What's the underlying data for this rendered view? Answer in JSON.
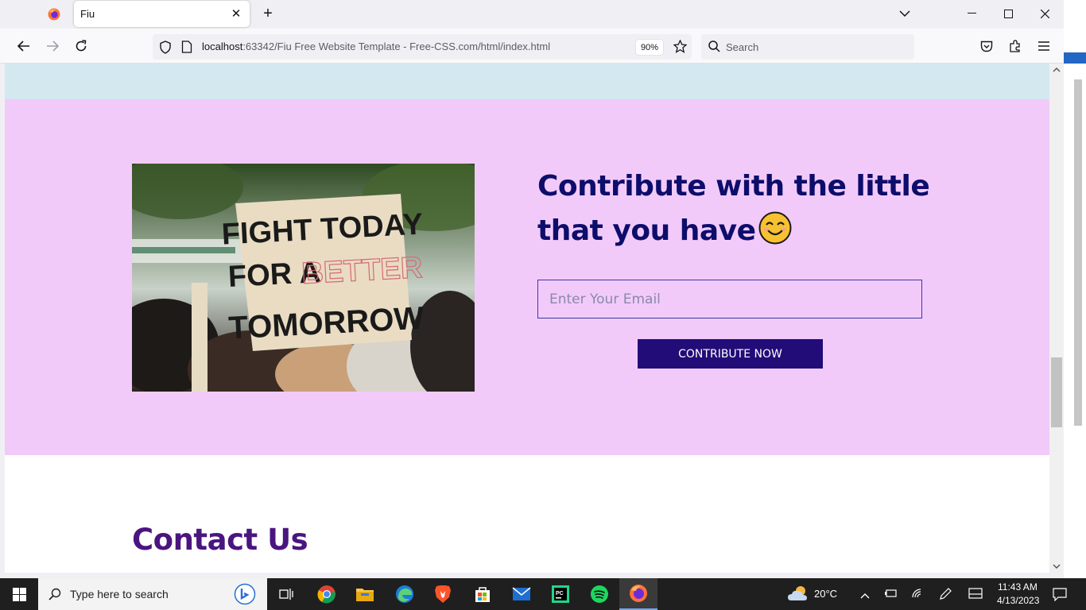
{
  "browser": {
    "tab_title": "Fiu",
    "url_host": "localhost",
    "url_rest": ":63342/Fiu Free Website Template - Free-CSS.com/html/index.html",
    "zoom": "90%",
    "search_placeholder": "Search"
  },
  "page": {
    "photo_sign_lines": [
      "FIGHT TODAY",
      "FOR A",
      "BETTER",
      "TOMORROW"
    ],
    "heading_line1": "Contribute with the little",
    "heading_line2": "that you have",
    "email_placeholder": "Enter Your Email",
    "contribute_label": "CONTRIBUTE NOW",
    "contact_title": "Contact Us"
  },
  "taskbar": {
    "search_placeholder": "Type here to search",
    "apps": [
      "task-view-icon",
      "chrome-icon",
      "file-explorer-icon",
      "edge-icon",
      "brave-icon",
      "microsoft-store-icon",
      "mail-icon",
      "pycharm-icon",
      "spotify-icon",
      "firefox-icon"
    ],
    "weather": "20°C",
    "time": "11:43 AM",
    "date": "4/13/2023"
  },
  "colors": {
    "section_pink": "#f2caf9",
    "top_band_blue": "#d4e8f0",
    "heading_navy": "#0d0d6b",
    "button_bg": "#220c78",
    "contact_purple": "#4b1580"
  }
}
